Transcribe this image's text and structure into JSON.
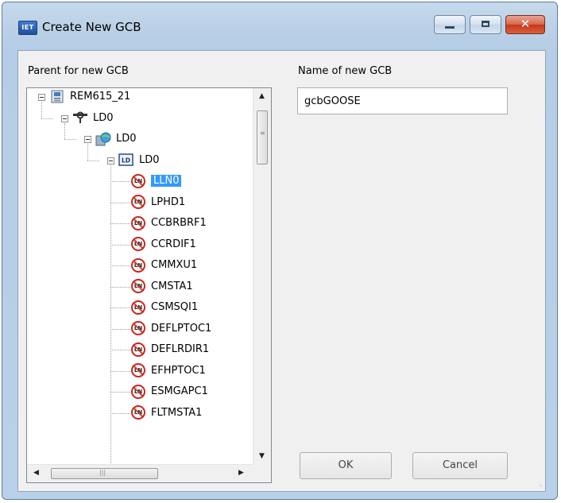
{
  "window": {
    "app_icon_text": "IET",
    "title": "Create New GCB"
  },
  "labels": {
    "parent": "Parent for new GCB",
    "name": "Name of new GCB"
  },
  "tree": [
    {
      "label": "REM615_21",
      "level": 0,
      "icon": "ied-device-icon",
      "expanded": true,
      "selected": false
    },
    {
      "label": "LD0",
      "level": 1,
      "icon": "access-point-icon",
      "expanded": true,
      "selected": false
    },
    {
      "label": "LD0",
      "level": 2,
      "icon": "server-globe-icon",
      "expanded": true,
      "selected": false
    },
    {
      "label": "LD0",
      "level": 3,
      "icon": "logical-device-icon",
      "expanded": true,
      "selected": false
    },
    {
      "label": "LLN0",
      "level": 4,
      "icon": "logical-node-icon",
      "expanded": false,
      "selected": true
    },
    {
      "label": "LPHD1",
      "level": 4,
      "icon": "logical-node-icon",
      "expanded": false,
      "selected": false
    },
    {
      "label": "CCBRBRF1",
      "level": 4,
      "icon": "logical-node-icon",
      "expanded": false,
      "selected": false
    },
    {
      "label": "CCRDIF1",
      "level": 4,
      "icon": "logical-node-icon",
      "expanded": false,
      "selected": false
    },
    {
      "label": "CMMXU1",
      "level": 4,
      "icon": "logical-node-icon",
      "expanded": false,
      "selected": false
    },
    {
      "label": "CMSTA1",
      "level": 4,
      "icon": "logical-node-icon",
      "expanded": false,
      "selected": false
    },
    {
      "label": "CSMSQI1",
      "level": 4,
      "icon": "logical-node-icon",
      "expanded": false,
      "selected": false
    },
    {
      "label": "DEFLPTOC1",
      "level": 4,
      "icon": "logical-node-icon",
      "expanded": false,
      "selected": false
    },
    {
      "label": "DEFLRDIR1",
      "level": 4,
      "icon": "logical-node-icon",
      "expanded": false,
      "selected": false
    },
    {
      "label": "EFHPTOC1",
      "level": 4,
      "icon": "logical-node-icon",
      "expanded": false,
      "selected": false
    },
    {
      "label": "ESMGAPC1",
      "level": 4,
      "icon": "logical-node-icon",
      "expanded": false,
      "selected": false
    },
    {
      "label": "FLTMSTA1",
      "level": 4,
      "icon": "logical-node-icon",
      "expanded": false,
      "selected": false
    }
  ],
  "name_input": {
    "value": "gcbGOOSE"
  },
  "buttons": {
    "ok": "OK",
    "cancel": "Cancel"
  },
  "icons": {
    "logical_node_badge": "LN",
    "logical_device_badge": "LD"
  },
  "colors": {
    "selection": "#3399ff",
    "close_button": "#c53818"
  }
}
